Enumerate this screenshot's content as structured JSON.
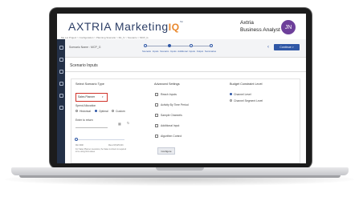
{
  "brand": {
    "name": "AXTRIA",
    "product": "Marketing",
    "suffix": "IQ",
    "trademark": "™"
  },
  "user": {
    "company": "Axtria",
    "role": "Business Analyst",
    "initials": "JN"
  },
  "breadcrumb": "Me Lst Project > Configuration > Planning Scenario > Mc_S > Scenario > MCP_G",
  "scenario_bar": {
    "name_label": "Scenario Name : MCP_G",
    "steps": "Scenario Inputs    Scenario Inputs    Additional Inputs    Output Summaries",
    "continue_label": "Continue >",
    "back_icon": "chevron-left-icon"
  },
  "section_title": "Scenario Inputs",
  "scenario_type": {
    "title": "Select Scenario Type",
    "selected": "Sales Planner",
    "spend_allocation_label": "Spend Allocation",
    "options": [
      "Historical",
      "Optimal",
      "Custom"
    ],
    "selected_option": "Optimal",
    "enter_return_label": "Enter to return",
    "min_label": "Min 000K",
    "max_label": "Max 215,625,643",
    "note": "For Sales Planner scenarios, the Sales is shown is required to be using limit values",
    "slider_position": 0
  },
  "advanced": {
    "title": "Advanced Settings",
    "items": [
      "Reach Inputs",
      "Activity By Time Period",
      "Sample Channels",
      "Additional Input",
      "Algorithm Control"
    ],
    "configure_label": "Configure"
  },
  "budget": {
    "title": "Budget Constraint Level",
    "options": [
      "Channel Level",
      "Channel Segment Level"
    ],
    "selected": "Channel Level"
  },
  "colors": {
    "primary": "#2f57a6",
    "sidebar": "#233047",
    "highlight": "#d0342c",
    "avatar": "#6d3f9a",
    "brand_accent": "#e8862a"
  }
}
